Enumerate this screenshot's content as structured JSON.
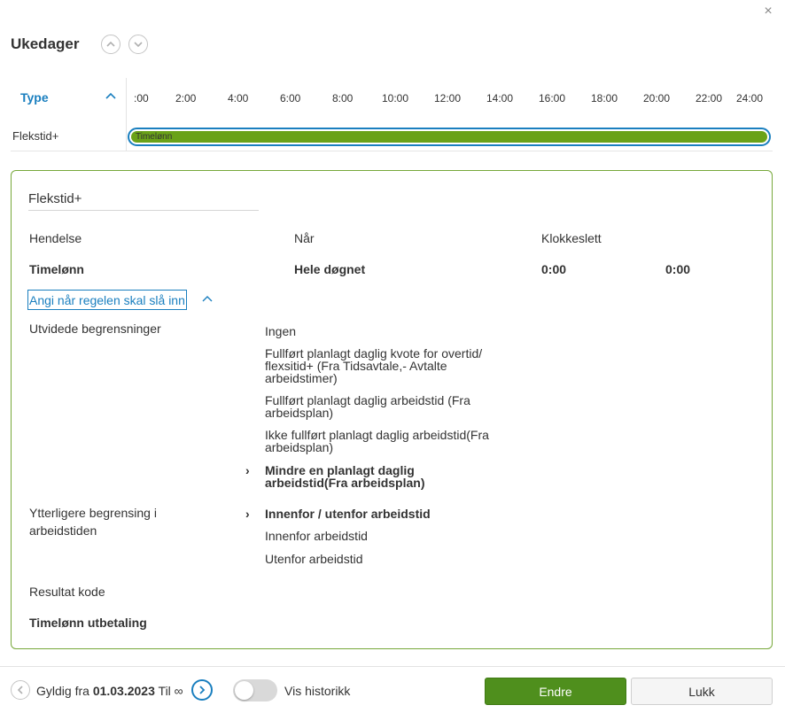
{
  "dialog": {
    "title": "Ukedager",
    "close_icon": "×"
  },
  "timeline": {
    "column_header": "Type",
    "ticks": [
      ":00",
      "2:00",
      "4:00",
      "6:00",
      "8:00",
      "10:00",
      "12:00",
      "14:00",
      "16:00",
      "18:00",
      "20:00",
      "22:00",
      "24:00"
    ],
    "row": {
      "label": "Flekstid+",
      "bar_label": "Timelønn",
      "bar_color": "#6aa218",
      "selected_outline_color": "#1a7fbf"
    }
  },
  "card": {
    "title": "Flekstid+",
    "headers": {
      "event": "Hendelse",
      "when": "Når",
      "time": "Klokkeslett"
    },
    "values": {
      "event": "Timelønn",
      "when": "Hele døgnet",
      "time_from": "0:00",
      "time_to": "0:00"
    },
    "rule_link": "Angi når regelen skal slå inn",
    "extended_label": "Utvidede begrensninger",
    "extended_options": [
      "Ingen",
      "Fullført planlagt daglig kvote for overtid/ flexsitid+ (Fra Tidsavtale,- Avtalte arbeidstimer)",
      "Fullført planlagt daglig arbeidstid (Fra arbeidsplan)",
      "Ikke fullført planlagt daglig arbeidstid(Fra arbeidsplan)",
      "Mindre en planlagt daglig arbeidstid(Fra arbeidsplan)"
    ],
    "further_label": "Ytterligere begrensing i arbeidstiden",
    "further_options": [
      "Innenfor / utenfor arbeidstid",
      "Innenfor arbeidstid",
      "Utenfor arbeidstid"
    ],
    "result_label": "Resultat kode",
    "result_value": "Timelønn utbetaling",
    "border_color": "#77a83a"
  },
  "footer": {
    "valid_prefix": "Gyldig fra",
    "valid_date": "01.03.2023",
    "valid_suffix": "Til ∞",
    "history_label": "Vis historikk",
    "history_on": false,
    "primary_button": "Endre",
    "secondary_button": "Lukk",
    "primary_color": "#4f8f1d"
  }
}
